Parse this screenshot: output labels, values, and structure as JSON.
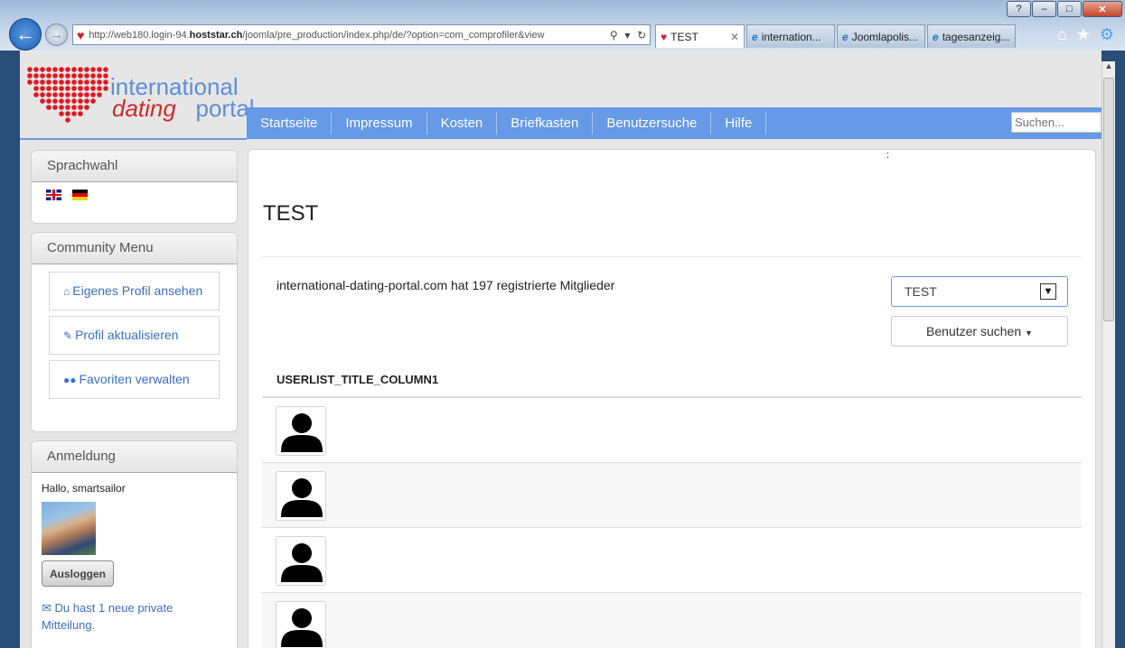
{
  "browser": {
    "url_prefix": "http://web180.login-94.",
    "url_host": "hoststar.ch",
    "url_rest": "/joomla/pre_production/index.php/de/?option=com_comprofiler&view",
    "tabs": [
      {
        "label": "TEST",
        "active": true
      },
      {
        "label": "internation..."
      },
      {
        "label": "Joomlapolis..."
      },
      {
        "label": "tagesanzeig..."
      }
    ]
  },
  "logo": {
    "line1": "international",
    "line2a": "dating",
    "line2b": "portal"
  },
  "nav": {
    "items": [
      "Startseite",
      "Impressum",
      "Kosten",
      "Briefkasten",
      "Benutzersuche",
      "Hilfe"
    ],
    "search_placeholder": "Suchen..."
  },
  "sidebar": {
    "language": {
      "title": "Sprachwahl"
    },
    "community": {
      "title": "Community Menu",
      "items": [
        "Eigenes Profil ansehen",
        "Profil aktualisieren",
        "Favoriten verwalten"
      ]
    },
    "login": {
      "title": "Anmeldung",
      "greeting": "Hallo, smartsailor",
      "logout": "Ausloggen",
      "message": "Du hast 1 neue private Mitteilung."
    }
  },
  "main": {
    "dot": ":",
    "title": "TEST",
    "member_count": "international-dating-portal.com hat 197 registrierte Mitglieder",
    "list_select": "TEST",
    "search_button": "Benutzer suchen",
    "column_header": "USERLIST_TITLE_COLUMN1"
  },
  "colors": {
    "accent": "#6699e6",
    "link": "#3b6fc4",
    "brand_red": "#d12a2a"
  }
}
